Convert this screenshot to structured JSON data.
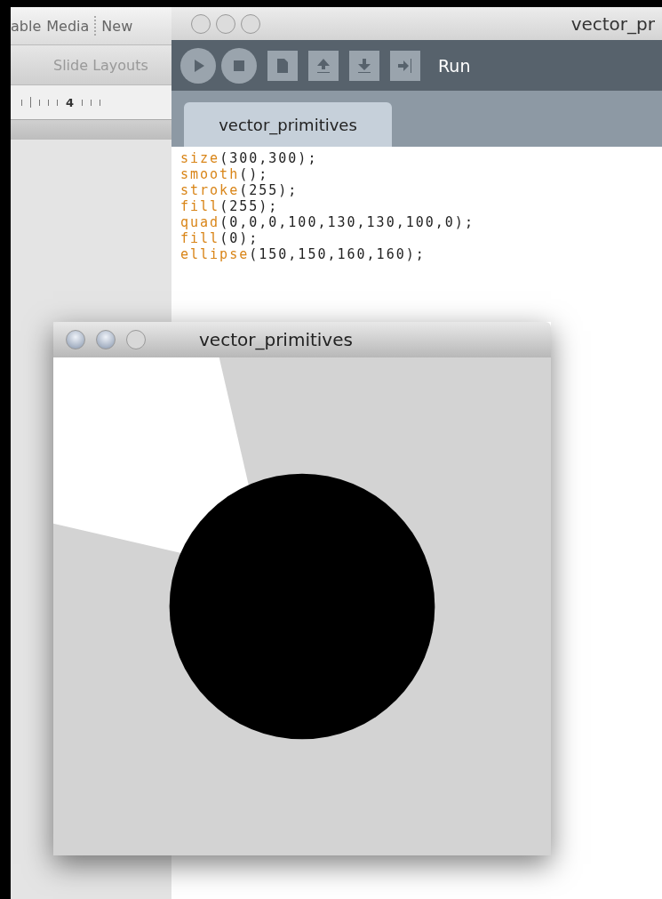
{
  "back_window": {
    "menu": [
      "able",
      "Media",
      "New"
    ],
    "toolbar_label": "Slide Layouts",
    "ruler_mark": "4"
  },
  "editor_window": {
    "title": "vector_pr",
    "toolbar_label": "Run",
    "tabs": [
      {
        "label": "vector_primitives",
        "selected": true
      }
    ],
    "code": [
      {
        "keyword": "size",
        "rest": "(300,300);"
      },
      {
        "keyword": "smooth",
        "rest": "();"
      },
      {
        "keyword": "stroke",
        "rest": "(255);"
      },
      {
        "keyword": "fill",
        "rest": "(255);"
      },
      {
        "keyword": "quad",
        "rest": "(0,0,0,100,130,130,100,0);"
      },
      {
        "keyword": "fill",
        "rest": "(0);"
      },
      {
        "keyword": "ellipse",
        "rest": "(150,150,160,160);"
      }
    ]
  },
  "sketch_window": {
    "title": "vector_primitives"
  }
}
